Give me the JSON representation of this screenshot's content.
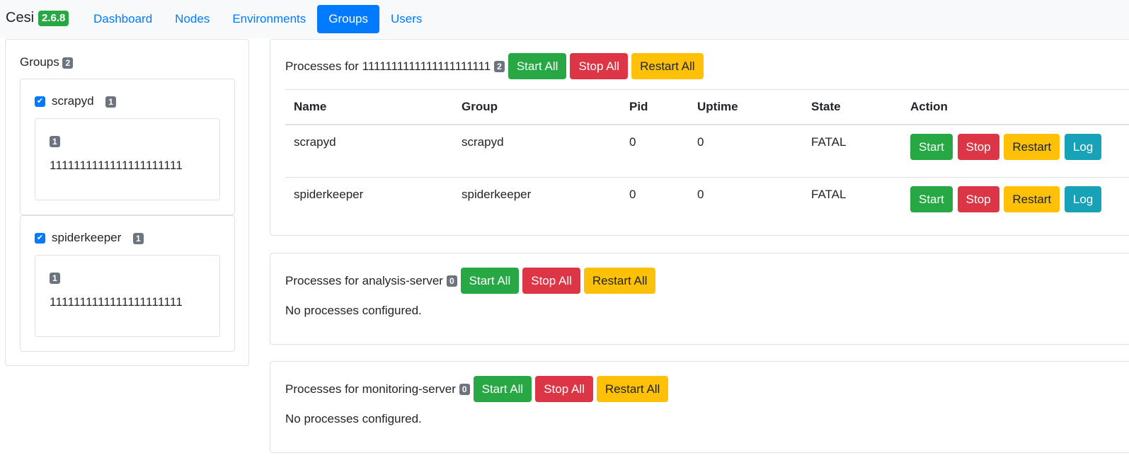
{
  "navbar": {
    "brand": "Cesi",
    "version": "2.6.8",
    "links": [
      {
        "label": "Dashboard",
        "active": false
      },
      {
        "label": "Nodes",
        "active": false
      },
      {
        "label": "Environments",
        "active": false
      },
      {
        "label": "Groups",
        "active": true
      },
      {
        "label": "Users",
        "active": false
      }
    ]
  },
  "sidebar": {
    "title": "Groups",
    "count": "2",
    "groups": [
      {
        "name": "scrapyd",
        "checked": true,
        "count": "1",
        "inner_count": "1",
        "inner_text": "1111111111111111111111"
      },
      {
        "name": "spiderkeeper",
        "checked": true,
        "count": "1",
        "inner_count": "1",
        "inner_text": "1111111111111111111111"
      }
    ]
  },
  "panels": [
    {
      "title": "Processes for 1111111111111111111111",
      "count": "2",
      "start_all": "Start All",
      "stop_all": "Stop All",
      "restart_all": "Restart All",
      "table": {
        "headers": [
          "Name",
          "Group",
          "Pid",
          "Uptime",
          "State",
          "Action"
        ],
        "rows": [
          {
            "name": "scrapyd",
            "group": "scrapyd",
            "pid": "0",
            "uptime": "0",
            "state": "FATAL"
          },
          {
            "name": "spiderkeeper",
            "group": "spiderkeeper",
            "pid": "0",
            "uptime": "0",
            "state": "FATAL"
          }
        ],
        "actions": {
          "start": "Start",
          "stop": "Stop",
          "restart": "Restart",
          "log": "Log"
        }
      }
    },
    {
      "title": "Processes for analysis-server",
      "count": "0",
      "start_all": "Start All",
      "stop_all": "Stop All",
      "restart_all": "Restart All",
      "empty": "No processes configured."
    },
    {
      "title": "Processes for monitoring-server",
      "count": "0",
      "start_all": "Start All",
      "stop_all": "Stop All",
      "restart_all": "Restart All",
      "empty": "No processes configured."
    }
  ],
  "colors": {
    "primary": "#007bff",
    "success": "#28a745",
    "danger": "#dc3545",
    "warning": "#ffc107",
    "info": "#17a2b8",
    "secondary": "#6c757d"
  }
}
